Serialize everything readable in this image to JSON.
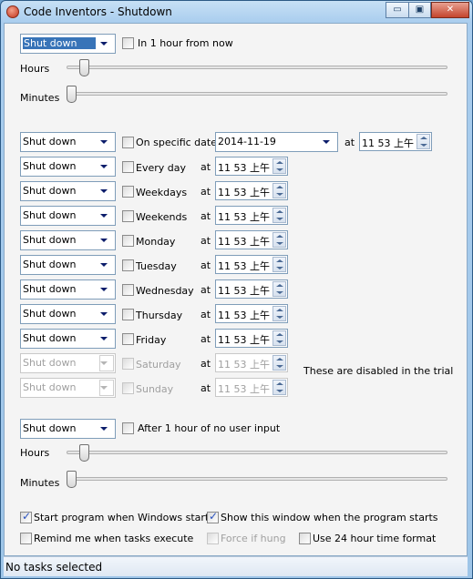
{
  "window": {
    "title": "Code Inventors - Shutdown",
    "minimize": "▭",
    "maximize": "▣",
    "close": "✕"
  },
  "top": {
    "action": "Shut down",
    "checkbox_label": "In 1 hour from now",
    "checked": false,
    "hours_label": "Hours",
    "minutes_label": "Minutes",
    "hours_value": 1,
    "minutes_value": 0
  },
  "specific": {
    "action": "Shut down",
    "checkbox_label": "On specific date",
    "checked": false,
    "date": "2014-11-19",
    "at": "at",
    "time": "11 53 上午"
  },
  "rows": [
    {
      "action": "Shut down",
      "label": "Every day",
      "at": "at",
      "time": "11 53 上午",
      "disabled": false
    },
    {
      "action": "Shut down",
      "label": "Weekdays",
      "at": "at",
      "time": "11 53 上午",
      "disabled": false
    },
    {
      "action": "Shut down",
      "label": "Weekends",
      "at": "at",
      "time": "11 53 上午",
      "disabled": false
    },
    {
      "action": "Shut down",
      "label": "Monday",
      "at": "at",
      "time": "11 53 上午",
      "disabled": false
    },
    {
      "action": "Shut down",
      "label": "Tuesday",
      "at": "at",
      "time": "11 53 上午",
      "disabled": false
    },
    {
      "action": "Shut down",
      "label": "Wednesday",
      "at": "at",
      "time": "11 53 上午",
      "disabled": false
    },
    {
      "action": "Shut down",
      "label": "Thursday",
      "at": "at",
      "time": "11 53 上午",
      "disabled": false
    },
    {
      "action": "Shut down",
      "label": "Friday",
      "at": "at",
      "time": "11 53 上午",
      "disabled": false
    },
    {
      "action": "Shut down",
      "label": "Saturday",
      "at": "at",
      "time": "11 53 上午",
      "disabled": true
    },
    {
      "action": "Shut down",
      "label": "Sunday",
      "at": "at",
      "time": "11 53 上午",
      "disabled": true
    }
  ],
  "trial_note": "These are disabled in the trial",
  "idle": {
    "action": "Shut down",
    "checkbox_label": "After 1 hour of no user input",
    "checked": false,
    "hours_label": "Hours",
    "minutes_label": "Minutes",
    "hours_value": 1,
    "minutes_value": 0
  },
  "options": {
    "start_with_windows": {
      "label": "Start program when Windows starts",
      "checked": true
    },
    "show_window": {
      "label": "Show this window when the program starts",
      "checked": true
    },
    "remind": {
      "label": "Remind me when tasks execute",
      "checked": false
    },
    "force_hung": {
      "label": "Force if hung",
      "checked": false,
      "disabled": true
    },
    "use_24h": {
      "label": "Use 24 hour time format",
      "checked": false
    }
  },
  "status": "No tasks selected"
}
